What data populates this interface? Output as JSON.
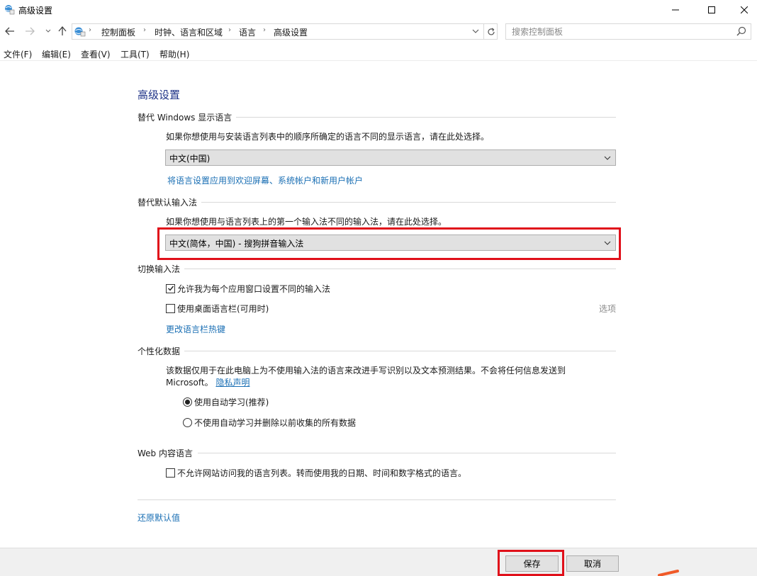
{
  "window": {
    "title": "高级设置",
    "controls": [
      "minimize",
      "maximize",
      "close"
    ]
  },
  "breadcrumb": {
    "items": [
      "控制面板",
      "时钟、语言和区域",
      "语言",
      "高级设置"
    ]
  },
  "search": {
    "placeholder": "搜索控制面板"
  },
  "menu": {
    "file": "文件(F)",
    "edit": "编辑(E)",
    "view": "查看(V)",
    "tools": "工具(T)",
    "help": "帮助(H)"
  },
  "page": {
    "title": "高级设置",
    "display_language": {
      "heading": "替代 Windows 显示语言",
      "description": "如果你想使用与安装语言列表中的顺序所确定的语言不同的显示语言，请在此处选择。",
      "selected": "中文(中国)",
      "apply_link": "将语言设置应用到欢迎屏幕、系统帐户和新用户帐户"
    },
    "default_input": {
      "heading": "替代默认输入法",
      "description": "如果你想使用与语言列表上的第一个输入法不同的输入法，请在此处选择。",
      "selected": "中文(简体，中国) - 搜狗拼音输入法"
    },
    "switch_input": {
      "heading": "切换输入法",
      "per_app_label": "允许我为每个应用窗口设置不同的输入法",
      "per_app_checked": true,
      "desktop_bar_label": "使用桌面语言栏(可用时)",
      "desktop_bar_checked": false,
      "options_label": "选项",
      "hotkeys_link": "更改语言栏热键"
    },
    "personalization": {
      "heading": "个性化数据",
      "description_line1": "该数据仅用于在此电脑上为不使用输入法的语言来改进手写识别以及文本预测结果。不会将任何信息发送到",
      "description_line2": "Microsoft。",
      "privacy_link": "隐私声明",
      "option_auto": "使用自动学习(推荐)",
      "option_no_auto": "不使用自动学习并删除以前收集的所有数据",
      "selected_option": "auto"
    },
    "web_content": {
      "heading": "Web 内容语言",
      "opt_out_label": "不允许网站访问我的语言列表。转而使用我的日期、时间和数字格式的语言。",
      "opt_out_checked": false
    },
    "restore_defaults": "还原默认值"
  },
  "footer": {
    "save": "保存",
    "cancel": "取消"
  },
  "colors": {
    "accent_title": "#1e3287",
    "link": "#1a6fb4",
    "highlight": "#e0101a",
    "arrow": "#f05a28"
  }
}
